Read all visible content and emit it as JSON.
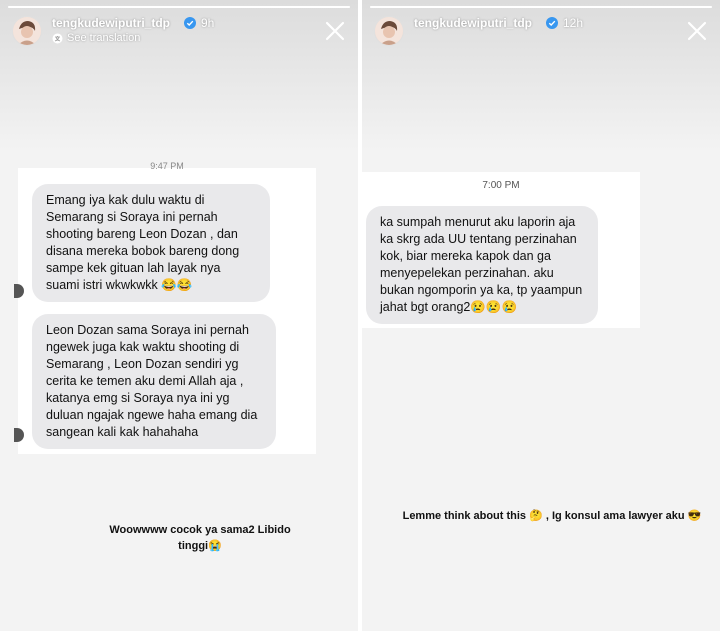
{
  "left_story": {
    "username": "tengkudewiputri_tdp",
    "time": "9h",
    "translation_label": "See translation",
    "progress_fraction": 1.0,
    "chat_timestamp": "9:47 PM",
    "messages": [
      "Emang iya kak dulu waktu di Semarang si Soraya ini pernah shooting bareng Leon Dozan , dan disana mereka bobok bareng dong sampe kek gituan lah layak nya suami istri wkwkwkk 😂😂",
      "Leon Dozan sama Soraya ini pernah ngewek juga kak waktu shooting di Semarang , Leon Dozan sendiri yg cerita ke temen aku demi Allah aja , katanya emg si Soraya nya ini yg duluan ngajak ngewe haha emang dia sangean kali kak hahahaha"
    ],
    "caption": "Woowwww cocok ya sama2 Libido tinggi😭"
  },
  "right_story": {
    "username": "tengkudewiputri_tdp",
    "time": "12h",
    "progress_fraction": 1.0,
    "chat_timestamp": "7:00 PM",
    "messages": [
      "ka sumpah menurut aku laporin aja ka skrg ada UU tentang perzinahan kok, biar mereka kapok dan ga menyepelekan perzinahan. aku bukan ngomporin ya ka, tp yaampun jahat bgt orang2😢😢😢"
    ],
    "caption": "Lemme think about this 🤔 , Ig konsul ama lawyer aku 😎"
  },
  "icons": {
    "verified": "verified-badge-icon",
    "close": "close-icon",
    "translation": "translate-icon"
  },
  "colors": {
    "verified": "#3897f0",
    "bubble": "#e9e9eb",
    "background": "#f3f3f3"
  }
}
